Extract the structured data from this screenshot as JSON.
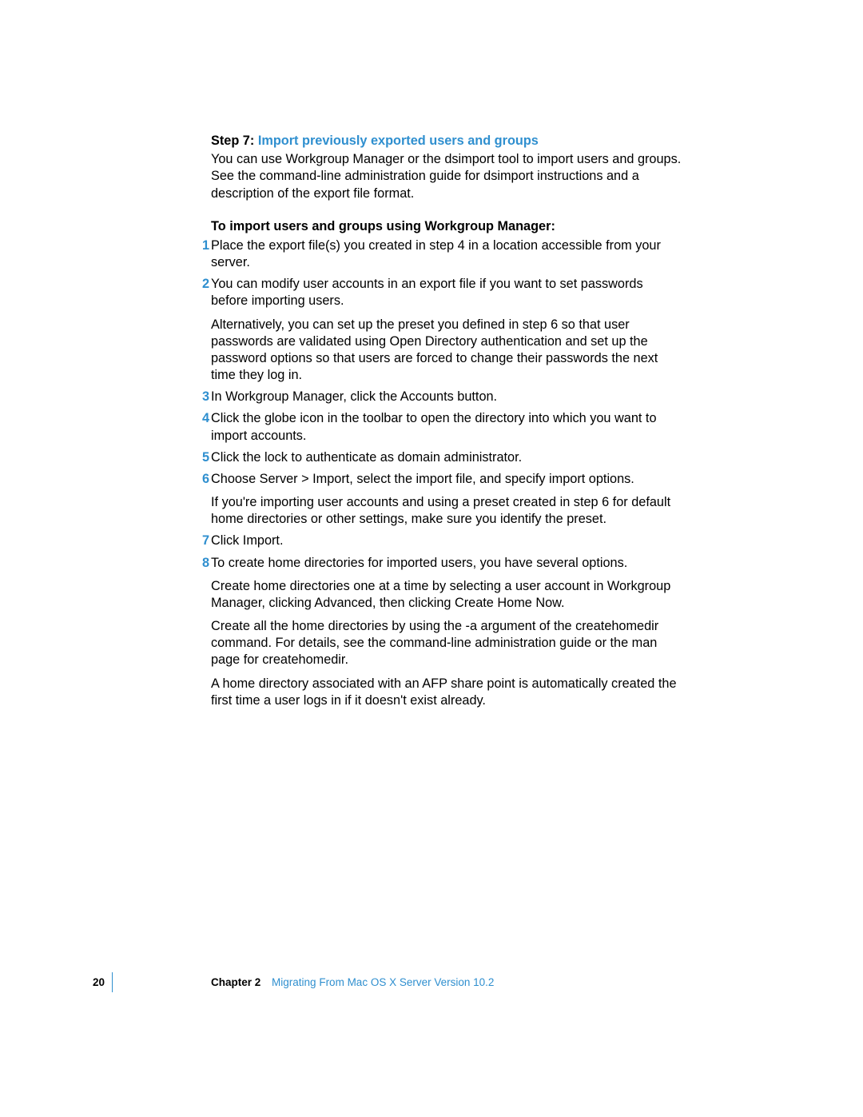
{
  "step": {
    "label": "Step 7:",
    "title": "Import previously exported users and groups"
  },
  "intro": "You can use Workgroup Manager or the dsimport tool to import users and groups. See the command-line administration guide for dsimport instructions and a description of the export file format.",
  "sub_heading": "To import users and groups using Workgroup Manager:",
  "items": [
    {
      "num": "1",
      "paras": [
        "Place the export file(s) you created in step 4 in a location accessible from your server."
      ]
    },
    {
      "num": "2",
      "paras": [
        "You can modify user accounts in an export file if you want to set passwords before importing users.",
        "Alternatively, you can set up the preset you defined in step 6 so that user passwords are validated using Open Directory authentication and set up the password options so that users are forced to change their passwords the next time they log in."
      ]
    },
    {
      "num": "3",
      "paras": [
        "In Workgroup Manager, click the Accounts button."
      ]
    },
    {
      "num": "4",
      "paras": [
        "Click the globe icon in the toolbar to open the directory into which you want to import accounts."
      ]
    },
    {
      "num": "5",
      "paras": [
        "Click the lock to authenticate as domain administrator."
      ]
    },
    {
      "num": "6",
      "paras": [
        "Choose Server > Import, select the import file, and specify import options.",
        "If you're importing user accounts and using a preset created in step 6 for default home directories or other settings, make sure you identify the preset."
      ]
    },
    {
      "num": "7",
      "paras": [
        "Click Import."
      ]
    },
    {
      "num": "8",
      "paras": [
        "To create home directories for imported users, you have several options.",
        "Create home directories one at a time by selecting a user account in Workgroup Manager, clicking Advanced, then clicking Create Home Now.",
        "Create all the home directories by using the -a argument of the createhomedir command. For details, see the command-line administration guide or the man page for createhomedir.",
        "A home directory associated with an AFP share point is automatically created the first time a user logs in if it doesn't exist already."
      ]
    }
  ],
  "footer": {
    "page": "20",
    "chapter_label": "Chapter 2",
    "chapter_title": "Migrating From Mac OS X Server Version 10.2"
  }
}
